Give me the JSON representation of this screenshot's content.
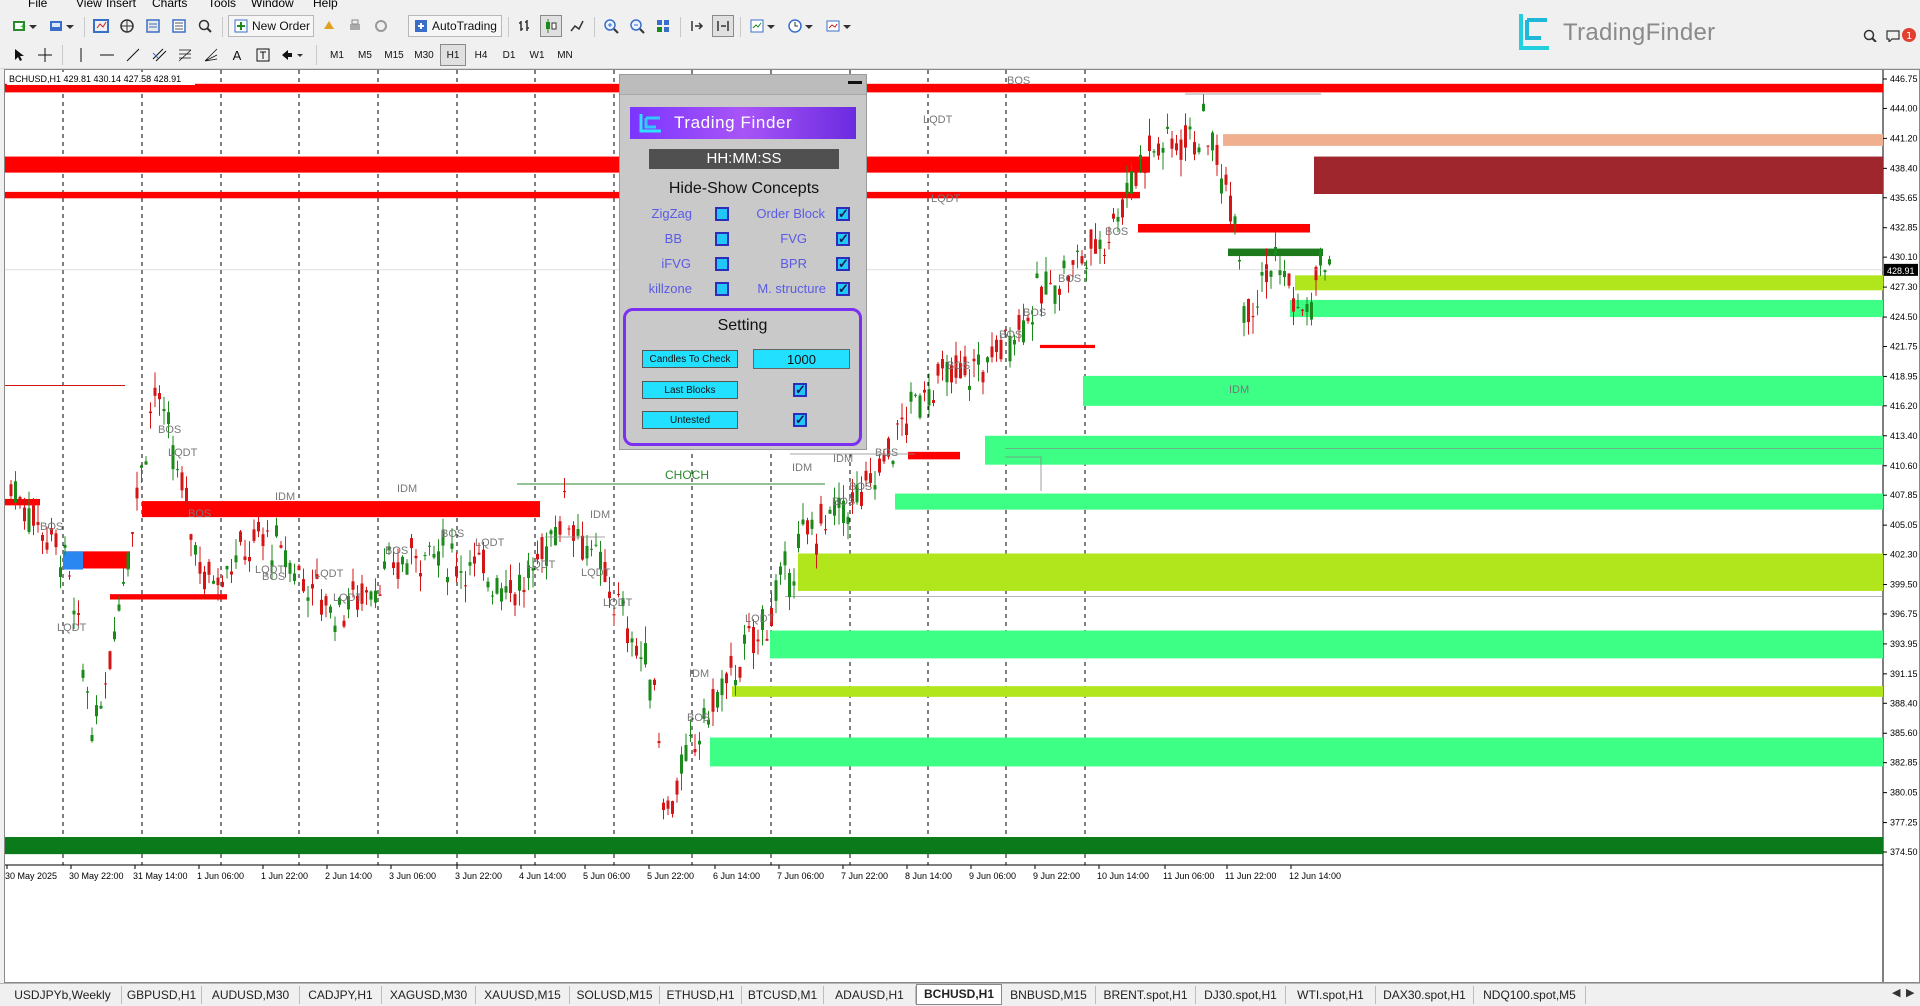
{
  "menu": [
    "File",
    "View",
    "Insert",
    "Charts",
    "Tools",
    "Window",
    "Help"
  ],
  "toolbar": {
    "new_order": "New Order",
    "auto_trading": "AutoTrading",
    "timeframes": [
      "M1",
      "M5",
      "M15",
      "M30",
      "H1",
      "H4",
      "D1",
      "W1",
      "MN"
    ],
    "active_timeframe": "H1"
  },
  "logo": {
    "text": "TradingFinder"
  },
  "chart": {
    "header": "BCHUSD,H1  429.81 430.14 427.58 428.91",
    "current_price": "428.91",
    "price_labels": [
      "446.75",
      "444.00",
      "441.20",
      "438.40",
      "435.65",
      "432.85",
      "430.10",
      "427.30",
      "424.50",
      "421.75",
      "418.95",
      "416.20",
      "413.40",
      "410.60",
      "407.85",
      "405.05",
      "402.30",
      "399.50",
      "396.75",
      "393.95",
      "391.15",
      "388.40",
      "385.60",
      "382.85",
      "380.05",
      "377.25",
      "374.50"
    ],
    "time_labels": [
      "30 May 2025",
      "30 May 22:00",
      "31 May 14:00",
      "1 Jun 06:00",
      "1 Jun 22:00",
      "2 Jun 14:00",
      "3 Jun 06:00",
      "3 Jun 22:00",
      "4 Jun 14:00",
      "5 Jun 06:00",
      "5 Jun 22:00",
      "6 Jun 14:00",
      "7 Jun 06:00",
      "7 Jun 22:00",
      "8 Jun 14:00",
      "9 Jun 06:00",
      "9 Jun 22:00",
      "10 Jun 14:00",
      "11 Jun 06:00",
      "11 Jun 22:00",
      "12 Jun 14:00"
    ],
    "annotations": {
      "bos": "BOS",
      "lqdt": "LQDT",
      "idm": "IDM",
      "choch": "CHOCH"
    },
    "colors": {
      "supply": "#ff0000",
      "supply_dark": "#a0262e",
      "supply_light": "#f0b090",
      "demand_green": "#3dff85",
      "fvg_lime": "#b2e61c",
      "bullish_candle": "#1a8a1a",
      "bearish_candle": "#d41515",
      "bottom_band": "#0b7a1a"
    }
  },
  "panel": {
    "banner": "Trading Finder",
    "clock": "HH:MM:SS",
    "concepts_title": "Hide-Show Concepts",
    "concepts": [
      {
        "label": "ZigZag",
        "checked": false
      },
      {
        "label": "Order Block",
        "checked": true
      },
      {
        "label": "BB",
        "checked": false
      },
      {
        "label": "FVG",
        "checked": true
      },
      {
        "label": "iFVG",
        "checked": false
      },
      {
        "label": "BPR",
        "checked": true
      },
      {
        "label": "killzone",
        "checked": false
      },
      {
        "label": "M. structure",
        "checked": true
      }
    ],
    "setting_title": "Setting",
    "candles_label": "Candles To Check",
    "candles_value": "1000",
    "last_blocks_label": "Last Blocks",
    "last_blocks_checked": true,
    "untested_label": "Untested",
    "untested_checked": true
  },
  "tabs": [
    "USDJPYb,Weekly",
    "GBPUSD,H1",
    "AUDUSD,M30",
    "CADJPY,H1",
    "XAGUSD,M30",
    "XAUUSD,M15",
    "SOLUSD,M15",
    "ETHUSD,H1",
    "BTCUSD,M1",
    "ADAUSD,H1",
    "BCHUSD,H1",
    "BNBUSD,M15",
    "BRENT.spot,H1",
    "DJ30.spot,H1",
    "WTI.spot,H1",
    "DAX30.spot,H1",
    "NDQ100.spot,M5"
  ],
  "active_tab": "BCHUSD,H1"
}
